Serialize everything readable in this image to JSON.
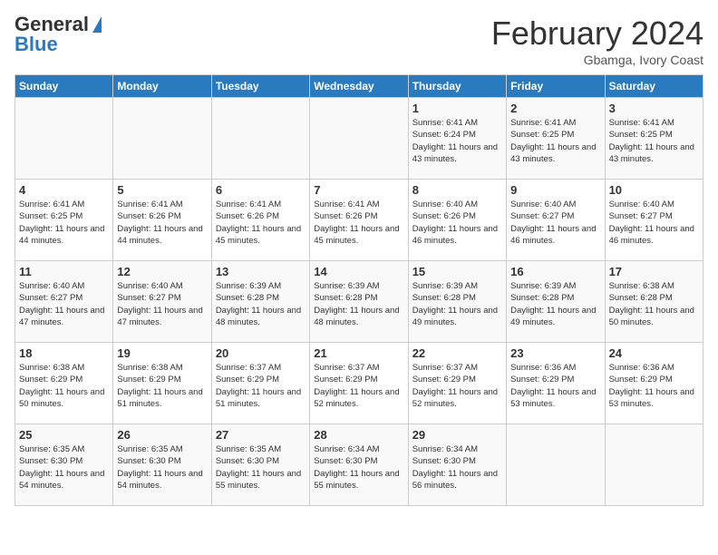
{
  "header": {
    "logo_general": "General",
    "logo_blue": "Blue",
    "title": "February 2024",
    "subtitle": "Gbamga, Ivory Coast"
  },
  "days_of_week": [
    "Sunday",
    "Monday",
    "Tuesday",
    "Wednesday",
    "Thursday",
    "Friday",
    "Saturday"
  ],
  "weeks": [
    [
      {
        "num": "",
        "info": ""
      },
      {
        "num": "",
        "info": ""
      },
      {
        "num": "",
        "info": ""
      },
      {
        "num": "",
        "info": ""
      },
      {
        "num": "1",
        "info": "Sunrise: 6:41 AM\nSunset: 6:24 PM\nDaylight: 11 hours and 43 minutes."
      },
      {
        "num": "2",
        "info": "Sunrise: 6:41 AM\nSunset: 6:25 PM\nDaylight: 11 hours and 43 minutes."
      },
      {
        "num": "3",
        "info": "Sunrise: 6:41 AM\nSunset: 6:25 PM\nDaylight: 11 hours and 43 minutes."
      }
    ],
    [
      {
        "num": "4",
        "info": "Sunrise: 6:41 AM\nSunset: 6:25 PM\nDaylight: 11 hours and 44 minutes."
      },
      {
        "num": "5",
        "info": "Sunrise: 6:41 AM\nSunset: 6:26 PM\nDaylight: 11 hours and 44 minutes."
      },
      {
        "num": "6",
        "info": "Sunrise: 6:41 AM\nSunset: 6:26 PM\nDaylight: 11 hours and 45 minutes."
      },
      {
        "num": "7",
        "info": "Sunrise: 6:41 AM\nSunset: 6:26 PM\nDaylight: 11 hours and 45 minutes."
      },
      {
        "num": "8",
        "info": "Sunrise: 6:40 AM\nSunset: 6:26 PM\nDaylight: 11 hours and 46 minutes."
      },
      {
        "num": "9",
        "info": "Sunrise: 6:40 AM\nSunset: 6:27 PM\nDaylight: 11 hours and 46 minutes."
      },
      {
        "num": "10",
        "info": "Sunrise: 6:40 AM\nSunset: 6:27 PM\nDaylight: 11 hours and 46 minutes."
      }
    ],
    [
      {
        "num": "11",
        "info": "Sunrise: 6:40 AM\nSunset: 6:27 PM\nDaylight: 11 hours and 47 minutes."
      },
      {
        "num": "12",
        "info": "Sunrise: 6:40 AM\nSunset: 6:27 PM\nDaylight: 11 hours and 47 minutes."
      },
      {
        "num": "13",
        "info": "Sunrise: 6:39 AM\nSunset: 6:28 PM\nDaylight: 11 hours and 48 minutes."
      },
      {
        "num": "14",
        "info": "Sunrise: 6:39 AM\nSunset: 6:28 PM\nDaylight: 11 hours and 48 minutes."
      },
      {
        "num": "15",
        "info": "Sunrise: 6:39 AM\nSunset: 6:28 PM\nDaylight: 11 hours and 49 minutes."
      },
      {
        "num": "16",
        "info": "Sunrise: 6:39 AM\nSunset: 6:28 PM\nDaylight: 11 hours and 49 minutes."
      },
      {
        "num": "17",
        "info": "Sunrise: 6:38 AM\nSunset: 6:28 PM\nDaylight: 11 hours and 50 minutes."
      }
    ],
    [
      {
        "num": "18",
        "info": "Sunrise: 6:38 AM\nSunset: 6:29 PM\nDaylight: 11 hours and 50 minutes."
      },
      {
        "num": "19",
        "info": "Sunrise: 6:38 AM\nSunset: 6:29 PM\nDaylight: 11 hours and 51 minutes."
      },
      {
        "num": "20",
        "info": "Sunrise: 6:37 AM\nSunset: 6:29 PM\nDaylight: 11 hours and 51 minutes."
      },
      {
        "num": "21",
        "info": "Sunrise: 6:37 AM\nSunset: 6:29 PM\nDaylight: 11 hours and 52 minutes."
      },
      {
        "num": "22",
        "info": "Sunrise: 6:37 AM\nSunset: 6:29 PM\nDaylight: 11 hours and 52 minutes."
      },
      {
        "num": "23",
        "info": "Sunrise: 6:36 AM\nSunset: 6:29 PM\nDaylight: 11 hours and 53 minutes."
      },
      {
        "num": "24",
        "info": "Sunrise: 6:36 AM\nSunset: 6:29 PM\nDaylight: 11 hours and 53 minutes."
      }
    ],
    [
      {
        "num": "25",
        "info": "Sunrise: 6:35 AM\nSunset: 6:30 PM\nDaylight: 11 hours and 54 minutes."
      },
      {
        "num": "26",
        "info": "Sunrise: 6:35 AM\nSunset: 6:30 PM\nDaylight: 11 hours and 54 minutes."
      },
      {
        "num": "27",
        "info": "Sunrise: 6:35 AM\nSunset: 6:30 PM\nDaylight: 11 hours and 55 minutes."
      },
      {
        "num": "28",
        "info": "Sunrise: 6:34 AM\nSunset: 6:30 PM\nDaylight: 11 hours and 55 minutes."
      },
      {
        "num": "29",
        "info": "Sunrise: 6:34 AM\nSunset: 6:30 PM\nDaylight: 11 hours and 56 minutes."
      },
      {
        "num": "",
        "info": ""
      },
      {
        "num": "",
        "info": ""
      }
    ]
  ]
}
